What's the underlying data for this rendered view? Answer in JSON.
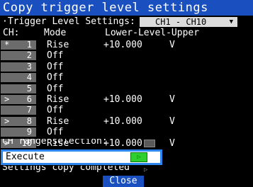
{
  "window": {
    "title": "Copy trigger level settings"
  },
  "trigger": {
    "label": "·Trigger Level Settings:",
    "channel_range": "CH1 - CH10",
    "dropdown_icon": "triangle-down-icon",
    "dropdown_glyph": "▼"
  },
  "columns": {
    "ch": "CH:",
    "mode": "Mode",
    "level": "Lower-Level-Upper"
  },
  "rows": [
    {
      "mark": "*",
      "ch": "1",
      "mode": "Rise",
      "lower": "+10.000",
      "upper": "V"
    },
    {
      "mark": "",
      "ch": "2",
      "mode": "Off",
      "lower": "",
      "upper": ""
    },
    {
      "mark": "",
      "ch": "3",
      "mode": "Off",
      "lower": "",
      "upper": ""
    },
    {
      "mark": "",
      "ch": "4",
      "mode": "Off",
      "lower": "",
      "upper": ""
    },
    {
      "mark": "",
      "ch": "5",
      "mode": "Off",
      "lower": "",
      "upper": ""
    },
    {
      "mark": ">",
      "ch": "6",
      "mode": "Rise",
      "lower": "+10.000",
      "upper": "V"
    },
    {
      "mark": "",
      "ch": "7",
      "mode": "Off",
      "lower": "",
      "upper": ""
    },
    {
      "mark": ">",
      "ch": "8",
      "mode": "Rise",
      "lower": "+10.000",
      "upper": "V"
    },
    {
      "mark": "",
      "ch": "9",
      "mode": "Off",
      "lower": "",
      "upper": ""
    },
    {
      "mark": ">",
      "ch": "10",
      "mode": "Rise",
      "lower": "+10.000",
      "upper": "V"
    }
  ],
  "range_selection": {
    "label": "CH range selection:",
    "icon": "range-select-icon"
  },
  "execute": {
    "label": "Execute",
    "button_glyph": "▷",
    "icon": "play-icon"
  },
  "status": {
    "label": "Settings copy completed",
    "icon": "play-icon",
    "glyph": "▷"
  },
  "footer": {
    "close_label": "Close"
  },
  "colors": {
    "title_bar": "#1a4fbf",
    "focus_border": "#2e86f0",
    "execute_button": "#2fcf2f",
    "channel_box": "#6c6c6c",
    "dropdown_bg": "#dcdcdc"
  }
}
